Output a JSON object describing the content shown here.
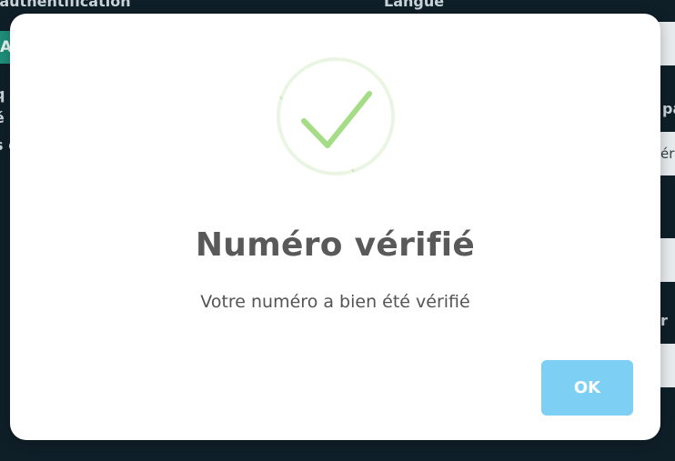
{
  "background": {
    "left_label": "ble authentification",
    "right_label": "Langue",
    "toggle_text": "A",
    "side_texts": [
      "q",
      "é",
      "s c"
    ],
    "right_labels": [
      "pa",
      "r"
    ],
    "input_values": [
      "",
      "ér",
      "",
      ""
    ]
  },
  "modal": {
    "icon": "success-check-icon",
    "icon_color": "#a5dc86",
    "icon_ring_color": "#eaf6e3",
    "title": "Numéro vérifié",
    "message": "Votre numéro a bien été vérifié",
    "ok_label": "OK",
    "ok_color": "#7ecff4"
  },
  "colors": {
    "page_background": "#0f1f28",
    "accent": "#1e8f7a"
  }
}
